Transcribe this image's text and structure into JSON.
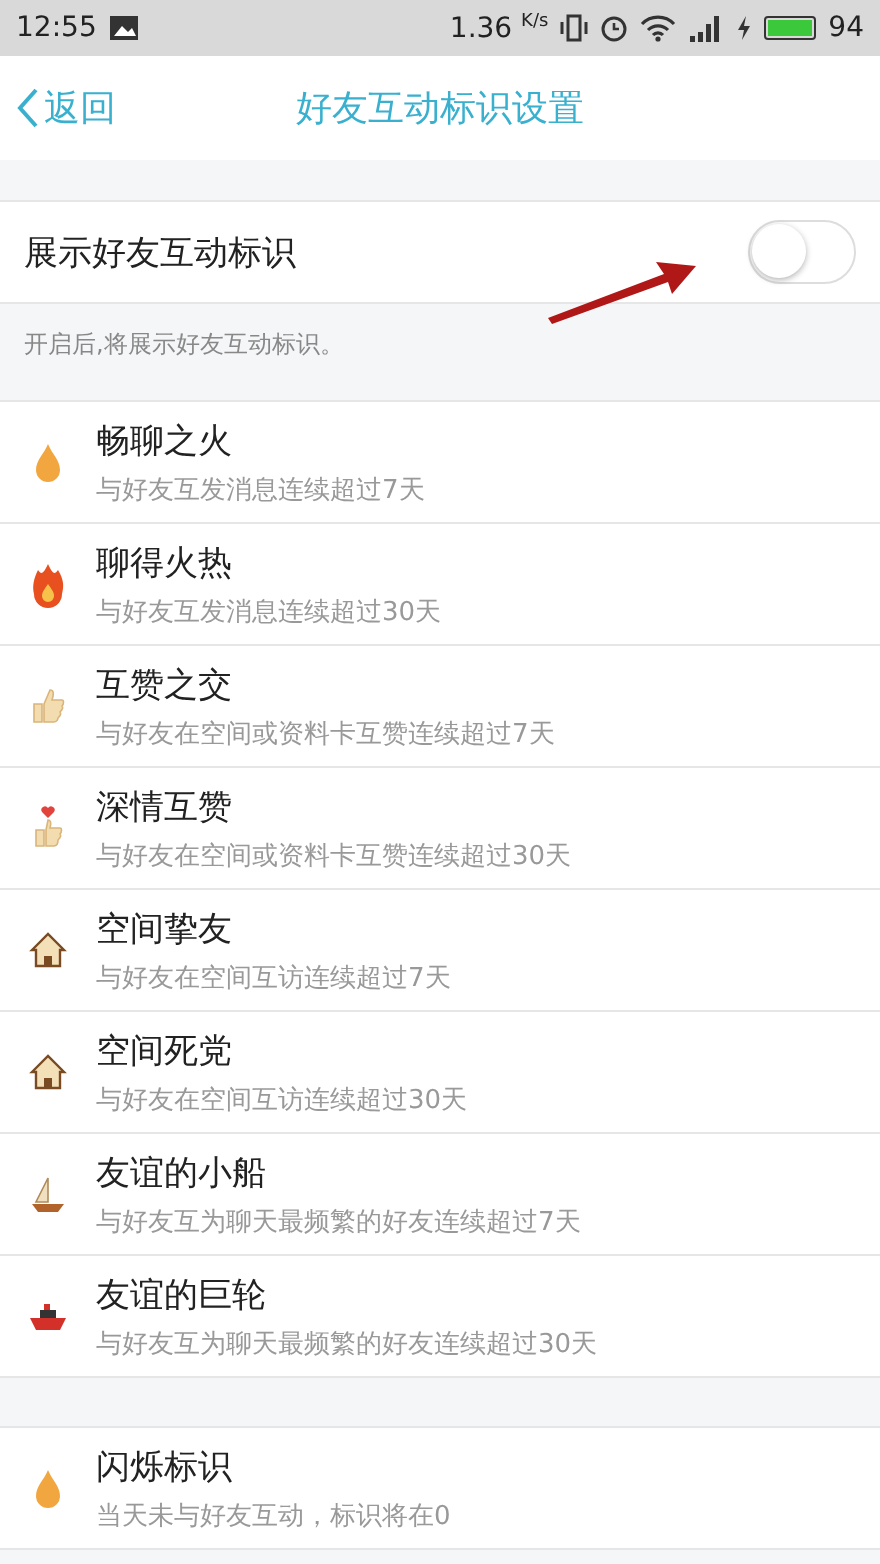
{
  "status_bar": {
    "time": "12:55",
    "speed": "1.36",
    "speed_unit": "K/s",
    "battery": "94"
  },
  "nav": {
    "back": "返回",
    "title": "好友互动标识设置"
  },
  "toggle": {
    "label": "展示好友互动标识",
    "on": false,
    "hint": "开启后,将展示好友互动标识。"
  },
  "items": [
    {
      "kind": "flame",
      "title": "畅聊之火",
      "subtitle": "与好友互发消息连续超过7天"
    },
    {
      "kind": "fire",
      "title": "聊得火热",
      "subtitle": "与好友互发消息连续超过30天"
    },
    {
      "kind": "thumb",
      "title": "互赞之交",
      "subtitle": "与好友在空间或资料卡互赞连续超过7天"
    },
    {
      "kind": "heart-thumb",
      "title": "深情互赞",
      "subtitle": "与好友在空间或资料卡互赞连续超过30天"
    },
    {
      "kind": "house",
      "title": "空间挚友",
      "subtitle": "与好友在空间互访连续超过7天"
    },
    {
      "kind": "house",
      "title": "空间死党",
      "subtitle": "与好友在空间互访连续超过30天"
    },
    {
      "kind": "sailboat",
      "title": "友谊的小船",
      "subtitle": "与好友互为聊天最频繁的好友连续超过7天"
    },
    {
      "kind": "ship",
      "title": "友谊的巨轮",
      "subtitle": "与好友互为聊天最频繁的好友连续超过30天"
    }
  ],
  "extra_items": [
    {
      "kind": "flame",
      "title": "闪烁标识",
      "subtitle": "当天未与好友互动，标识将在0"
    }
  ]
}
